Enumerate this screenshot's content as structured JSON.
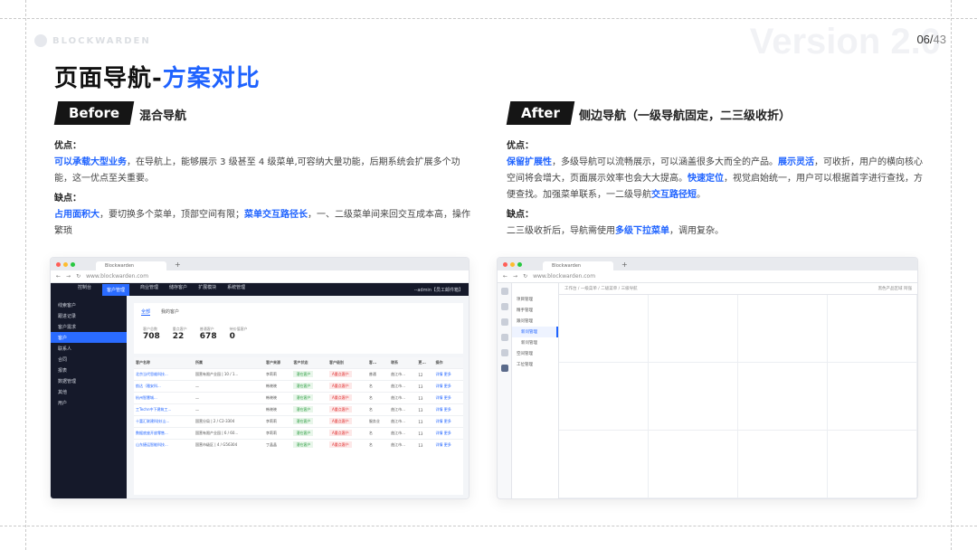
{
  "brand": {
    "text": "BLOCKWARDEN"
  },
  "watermark": "Version 2.0",
  "page": {
    "current": "06",
    "total": "43"
  },
  "title": {
    "main": "页面导航-",
    "accent": "方案对比"
  },
  "before": {
    "tag": "Before",
    "subtitle": "混合导航",
    "pros_label": "优点：",
    "pros_hl": "可以承载大型业务",
    "pros_text": "，在导航上，能够展示 3 级甚至 4 级菜单,可容纳大量功能，后期系统会扩展多个功能，这一优点至关重要。",
    "cons_label": "缺点：",
    "cons_hl1": "占用面积大",
    "cons_text1": "，要切换多个菜单，顶部空间有限；",
    "cons_hl2": "菜单交互路径长",
    "cons_text2": "，一、二级菜单间来回交互成本高，操作繁琐"
  },
  "after": {
    "tag": "After",
    "subtitle": "侧边导航（一级导航固定，二三级收折）",
    "pros_label": "优点：",
    "p1_hl": "保留扩展性",
    "p1_text": "，多级导航可以流畅展示，可以涵盖很多大而全的产品。",
    "p2_hl": "展示灵活",
    "p2_text": "，可收折，用户的横向核心空间将会增大，页面展示效率也会大大提高。",
    "p3_hl": "快速定位",
    "p3_text": "，视觉启始统一，用户可以根据首字进行查找，方便查找。加强菜单联系，一二级导航",
    "p4_hl": "交互路径短",
    "p4_text": "。",
    "cons_label": "缺点：",
    "cons_text1": "二三级收折后，导航需使用",
    "cons_hl": "多级下拉菜单",
    "cons_text2": "，调用复杂。"
  },
  "shot_before": {
    "tab": "Blockwarden",
    "url": "www.blockwarden.com",
    "top_menu": [
      "控制台",
      "客户管理",
      "商业管理",
      "储存客户",
      "扩展模块",
      "系统管理"
    ],
    "top_right": "--admin【员工邮件箱】",
    "side": [
      "线索客户",
      "跟进记录",
      "客户需求",
      "客户",
      "联系人",
      "合同",
      "报表",
      "数据管理",
      "其他",
      "用户"
    ],
    "subtabs": [
      "全部",
      "我的客户"
    ],
    "stats": [
      {
        "label": "客户总数",
        "value": "708"
      },
      {
        "label": "重点客户",
        "value": "22"
      },
      {
        "label": "普通客户",
        "value": "678"
      },
      {
        "label": "待价值客户",
        "value": "0"
      }
    ],
    "columns": [
      "客户名称",
      "所属",
      "客户来源",
      "客户状态",
      "客户级别",
      "客...",
      "联系",
      "更...",
      "操作"
    ],
    "rows": [
      [
        "北京当代思维科技...",
        "国营有限产业园 | 10 / 1...",
        "李莉莉",
        "潜在客户",
        "A重点客户",
        "普通",
        "曲江市...",
        "12",
        "详情  更多"
      ],
      [
        "航达（雅安科...",
        "—",
        "韩晓晓",
        "潜在客户",
        "A重点客户",
        "名",
        "曲江市...",
        "13",
        "详情  更多"
      ],
      [
        "杭州智慧城...",
        "—",
        "韩晓晓",
        "潜在客户",
        "A重点客户",
        "名",
        "曲江市...",
        "13",
        "详情  更多"
      ],
      [
        "工Techn中下建筑工...",
        "—",
        "韩晓晓",
        "潜在客户",
        "A重点客户",
        "名",
        "曲江市...",
        "13",
        "详情  更多"
      ],
      [
        "十富汇联建科技(山...",
        "国营分局 | 2 / C2-3304",
        "李莉莉",
        "潜在客户",
        "A重点客户",
        "服务业",
        "曲江市...",
        "13",
        "详情  更多"
      ],
      [
        "数据底座开放零售...",
        "国营有限产业园 | 6 / 60...",
        "李莉莉",
        "潜在客户",
        "A重点客户",
        "名",
        "曲江市...",
        "13",
        "详情  更多"
      ],
      [
        "山东捷运智能科技...",
        "国营市级区 | 4 / G56304",
        "丁晶晶",
        "潜在客户",
        "A重点客户",
        "名",
        "曲江市...",
        "13",
        "详情  更多"
      ]
    ]
  },
  "shot_after": {
    "tab": "Blockwarden",
    "url": "www.blockwarden.com",
    "nav": [
      "项目管理",
      "精手管理",
      "跟问管理",
      "新问管理",
      "新问管理",
      "空间管理",
      "工位管理"
    ],
    "breadcrumb": "工作台 / 一级菜单 / 二级菜单 / 三级导航",
    "top_right": "黑色产品区域",
    "user": "阿强"
  }
}
